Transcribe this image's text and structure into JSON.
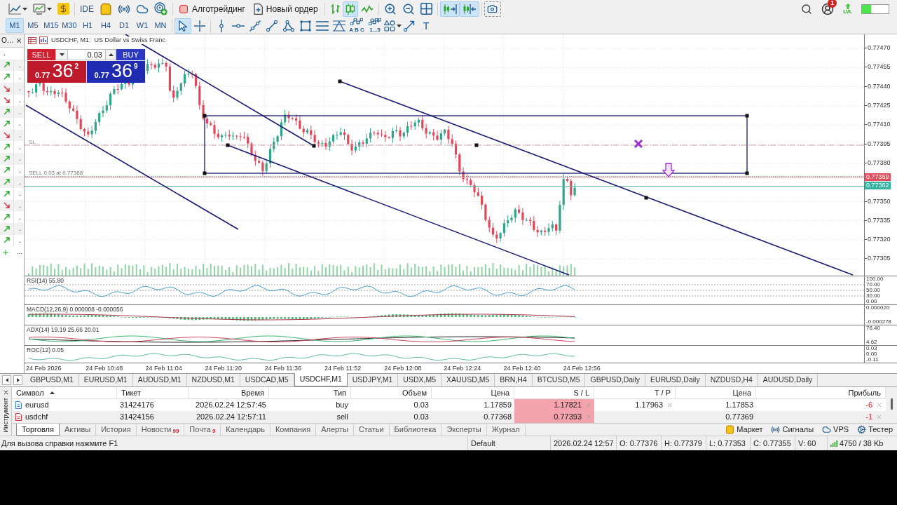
{
  "toolbar": {
    "ide_label": "IDE",
    "algo_trading": {
      "label": "Алготрейдинг",
      "on": false
    },
    "new_order": "Новый ордер",
    "chart_types": [
      {
        "selected": false
      },
      {
        "selected": true
      },
      {
        "selected": false
      }
    ],
    "auto_scroll": {
      "on": true
    },
    "chart_shift": {
      "on": true
    },
    "notification_badge": "1",
    "level_label": "LVL",
    "level_meter": {
      "level": 0.33
    }
  },
  "timeframes": [
    {
      "label": "M1",
      "selected": true
    },
    {
      "label": "M5",
      "selected": false
    },
    {
      "label": "M15",
      "selected": false
    },
    {
      "label": "M30",
      "selected": false
    },
    {
      "label": "H1",
      "selected": false
    },
    {
      "label": "H4",
      "selected": false
    },
    {
      "label": "D1",
      "selected": false
    },
    {
      "label": "W1",
      "selected": false
    },
    {
      "label": "MN",
      "selected": false
    }
  ],
  "drawing_tools": [
    {
      "selected": true
    },
    {
      "selected": false
    },
    {
      "selected": false
    },
    {
      "selected": false
    },
    {
      "selected": false
    },
    {
      "selected": false
    },
    {
      "selected": false
    },
    {
      "selected": false
    },
    {
      "selected": false
    },
    {
      "selected": false
    },
    {
      "caption": "A B C",
      "selected": false
    },
    {
      "caption": "1...5",
      "selected": false
    },
    {
      "selected": false
    },
    {
      "selected": false
    },
    {
      "glyph": "T",
      "selected": false
    }
  ],
  "market_watch": {
    "title": "О…",
    "header": ".",
    "rows": [
      {
        "rising": true,
        "value": "."
      },
      {
        "rising": true,
        "value": "."
      },
      {
        "rising": false,
        "value": "."
      },
      {
        "rising": false,
        "value": "."
      },
      {
        "rising": true,
        "value": "."
      },
      {
        "rising": true,
        "value": "."
      },
      {
        "rising": false,
        "value": "."
      },
      {
        "rising": true,
        "value": "."
      },
      {
        "rising": true,
        "value": "."
      },
      {
        "rising": true,
        "value": "."
      },
      {
        "rising": true,
        "value": "."
      },
      {
        "rising": true,
        "value": "."
      },
      {
        "rising": false,
        "value": "."
      },
      {
        "rising": true,
        "value": "."
      },
      {
        "rising": true,
        "value": "."
      },
      {
        "rising": true,
        "value": "."
      }
    ],
    "more": "..."
  },
  "chart": {
    "title": "USDCHF, M1:  US Dollar vs Swiss Franc",
    "trade_panel": {
      "sell": {
        "label": "SELL",
        "price_prefix": "0.77",
        "price_big": "36",
        "price_sup": "2"
      },
      "volume": "0.03",
      "buy": {
        "label": "BUY",
        "price_prefix": "0.77",
        "price_big": "36",
        "price_sup": "9"
      }
    },
    "sl_label": "SL",
    "order_label": "SELL 0.03 at 0.77368",
    "price_axis": [
      "0.77470",
      "0.77455",
      "0.77440",
      "0.77425",
      "0.77410",
      "0.77395",
      "0.77380",
      "0.77350",
      "0.77335",
      "0.77320",
      "0.77305"
    ],
    "price_tags": [
      {
        "value": "0.77369",
        "color": "#e34d5b"
      },
      {
        "value": "0.77362",
        "color": "#30b3a0"
      }
    ],
    "indicators": [
      {
        "kind": "rsi",
        "label": "RSI(14) 55.80",
        "axis": [
          "100.00",
          "70.00",
          "50.00",
          "30.00",
          "0.00"
        ]
      },
      {
        "kind": "macd",
        "label": "MACD(12,26,9) 0.000008 -0.000056",
        "axis": [
          "0.000020",
          "-0.000278"
        ]
      },
      {
        "kind": "adx",
        "label": "ADX(14) 19.19 25.66 20.01",
        "axis": [
          "76.40",
          "4.62"
        ]
      },
      {
        "kind": "roc",
        "label": "ROC(12) 0.05",
        "axis": [
          "0.03",
          "0.00",
          "-0.11"
        ]
      }
    ],
    "time_axis": [
      "24 Feb 2026",
      "24 Feb 10:48",
      "24 Feb 11:04",
      "24 Feb 11:20",
      "24 Feb 11:36",
      "24 Feb 11:52",
      "24 Feb 12:08",
      "24 Feb 12:24",
      "24 Feb 12:40",
      "24 Feb 12:56"
    ]
  },
  "chart_tabs": [
    {
      "label": "GBPUSD,M1",
      "selected": false
    },
    {
      "label": "EURUSD,M1",
      "selected": false
    },
    {
      "label": "AUDUSD,M1",
      "selected": false
    },
    {
      "label": "NZDUSD,M1",
      "selected": false
    },
    {
      "label": "USDCAD,M5",
      "selected": false
    },
    {
      "label": "USDCHF,M1",
      "selected": true
    },
    {
      "label": "USDJPY,M1",
      "selected": false
    },
    {
      "label": "USDX,M5",
      "selected": false
    },
    {
      "label": "XAUUSD,M5",
      "selected": false
    },
    {
      "label": "BRN,H4",
      "selected": false
    },
    {
      "label": "BTCUSD,M5",
      "selected": false
    },
    {
      "label": "GBPUSD,Daily",
      "selected": false
    },
    {
      "label": "EURUSD,Daily",
      "selected": false
    },
    {
      "label": "NZDUSD,H4",
      "selected": false
    },
    {
      "label": "AUDUSD,Daily",
      "selected": false
    }
  ],
  "terminal": {
    "side_label": "Инструмент",
    "columns": [
      {
        "label": "Символ",
        "sorted": true
      },
      {
        "label": "Тикет"
      },
      {
        "label": "Время"
      },
      {
        "label": "Тип"
      },
      {
        "label": "Объем"
      },
      {
        "label": "Цена"
      },
      {
        "label": "S / L"
      },
      {
        "label": "T / P"
      },
      {
        "label": "Цена"
      },
      {
        "label": "Прибыль"
      }
    ],
    "rows": [
      {
        "kind": "buy",
        "symbol": "eurusd",
        "ticket": "31424176",
        "time": "2026.02.24 12:57:45",
        "type": "buy",
        "volume": "0.03",
        "price": "1.17859",
        "sl": "1.17821",
        "sl_highlighted": true,
        "tp": "1.17963",
        "current": "1.17853",
        "profit": "-6",
        "loss": true
      },
      {
        "kind": "sell",
        "symbol": "usdchf",
        "ticket": "31424156",
        "time": "2026.02.24 12:57:11",
        "type": "sell",
        "volume": "0.03",
        "price": "0.77368",
        "sl": "0.77393",
        "sl_highlighted": true,
        "current": "0.77369",
        "profit": "-1",
        "loss": true
      }
    ],
    "tabs": [
      {
        "label": "Торговля",
        "selected": true
      },
      {
        "label": "Активы",
        "selected": false
      },
      {
        "label": "История",
        "selected": false
      },
      {
        "label": "Новости",
        "badge": "99",
        "selected": false
      },
      {
        "label": "Почта",
        "badge": "9",
        "selected": false
      },
      {
        "label": "Календарь",
        "selected": false
      },
      {
        "label": "Компания",
        "selected": false
      },
      {
        "label": "Алерты",
        "selected": false
      },
      {
        "label": "Статьи",
        "selected": false
      },
      {
        "label": "Библиотека",
        "selected": false
      },
      {
        "label": "Эксперты",
        "selected": false
      },
      {
        "label": "Журнал",
        "selected": false
      }
    ],
    "services": [
      "Маркет",
      "Сигналы",
      "VPS",
      "Тестер"
    ]
  },
  "status_bar": {
    "help": "Для вызова справки нажмите F1",
    "profile": "Default",
    "datetime": "2026.02.24 12:57",
    "open": "O: 0.77376",
    "high": "H: 0.77379",
    "low": "L: 0.77353",
    "close": "C: 0.77355",
    "volume": "V: 60",
    "traffic": "4750 / 38 Kb"
  }
}
